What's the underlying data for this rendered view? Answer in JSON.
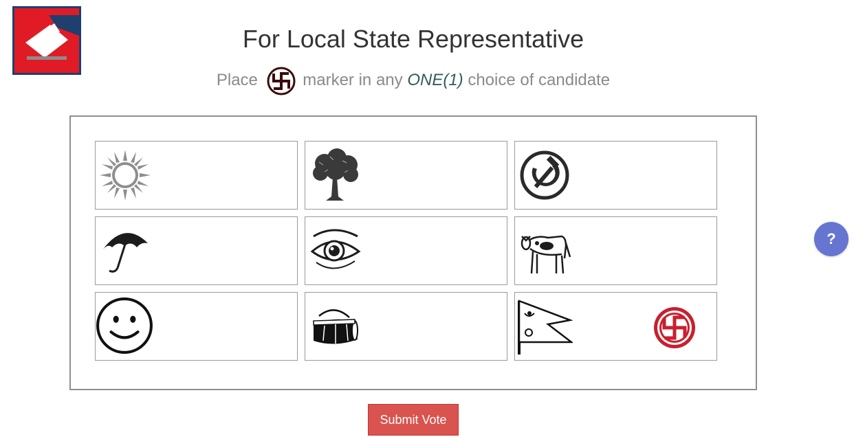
{
  "header": {
    "title": "For Local State Representative",
    "instruction_prefix": "Place",
    "instruction_middle": "marker in any",
    "instruction_emphasis": "ONE(1)",
    "instruction_suffix": "choice of candidate"
  },
  "ballot": {
    "candidates": [
      {
        "symbol": "sun-icon"
      },
      {
        "symbol": "tree-icon"
      },
      {
        "symbol": "hammer-sickle-icon"
      },
      {
        "symbol": "umbrella-icon"
      },
      {
        "symbol": "eye-icon"
      },
      {
        "symbol": "cow-icon"
      },
      {
        "symbol": "smiley-face-icon"
      },
      {
        "symbol": "madal-drum-icon"
      },
      {
        "symbol": "nepal-flag-icon",
        "marked": true
      }
    ]
  },
  "submit_label": "Submit Vote",
  "help_label": "?",
  "colors": {
    "brand_red": "#e01b25",
    "logo_border": "#1f3f6e",
    "submit_bg": "#d9534f",
    "help_bg": "#6675d0",
    "vote_marker": "#c8202f"
  }
}
